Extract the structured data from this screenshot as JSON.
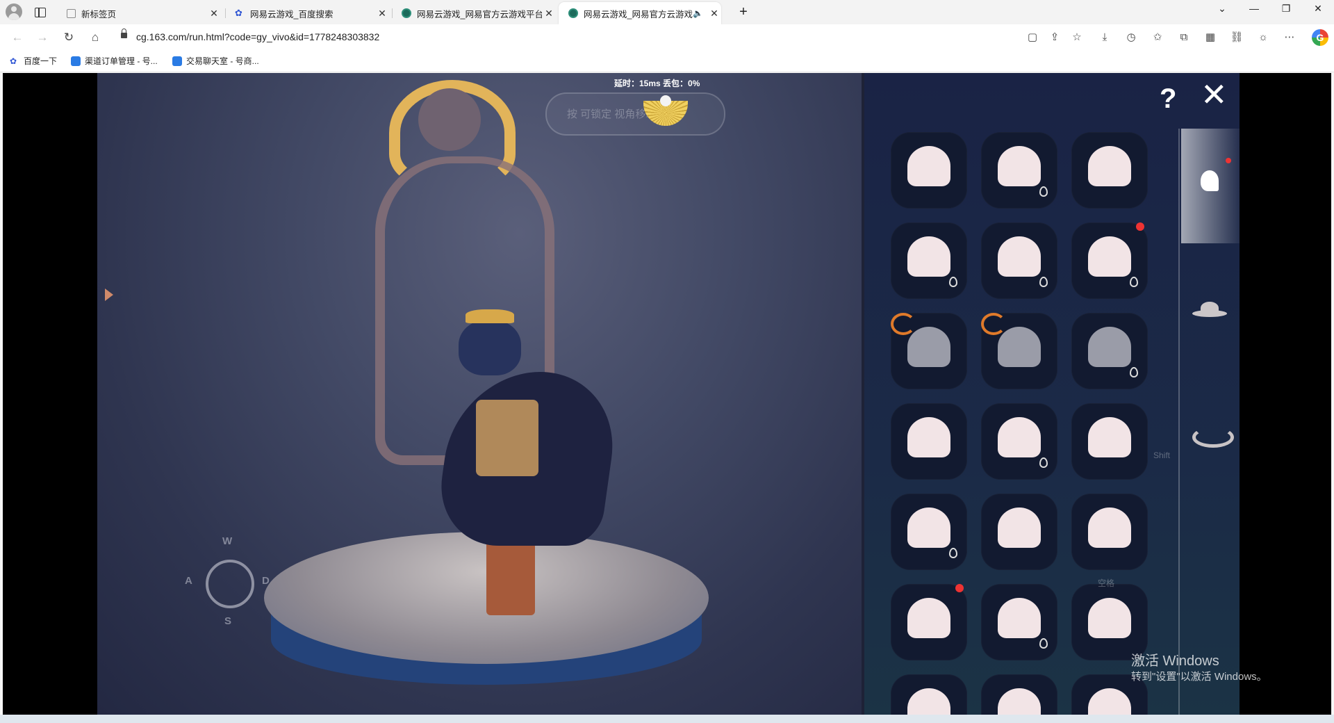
{
  "tabs": [
    {
      "title": "新标签页",
      "active": false,
      "favicon_color": "#8c8c8c"
    },
    {
      "title": "网易云游戏_百度搜索",
      "active": false,
      "favicon_color": "#2f55d4"
    },
    {
      "title": "网易云游戏_网易官方云游戏平台",
      "active": false,
      "favicon_color": "#1c6b5b"
    },
    {
      "title": "网易云游戏_网易官方云游戏",
      "active": true,
      "favicon_color": "#1c6b5b"
    }
  ],
  "address": {
    "url": "cg.163.com/run.html?code=gy_vivo&id=1778248303832"
  },
  "bookmarks": [
    {
      "label": "百度一下",
      "icon_color": "#2f55d4"
    },
    {
      "label": "渠道订单管理 - 号...",
      "icon_color": "#2a7be4"
    },
    {
      "label": "交易聊天室 - 号商...",
      "icon_color": "#2a7be4"
    }
  ],
  "game": {
    "latency_text": "延时：15ms    丢包：0%",
    "hint_text": "按 可锁定 视角移动",
    "keys": {
      "w": "W",
      "a": "A",
      "s": "S",
      "d": "D"
    },
    "shift_label": "Shift",
    "space_label": "空格"
  },
  "watermark": {
    "line1": "激活 Windows",
    "line2": "转到\"设置\"以激活 Windows。"
  },
  "icons": [
    "profile-icon",
    "tabs-icon",
    "back-icon",
    "forward-icon",
    "reload-icon",
    "home-icon",
    "lock-icon",
    "help-icon",
    "close-icon",
    "hair-category-icon",
    "hat-category-icon",
    "horn-category-icon"
  ]
}
